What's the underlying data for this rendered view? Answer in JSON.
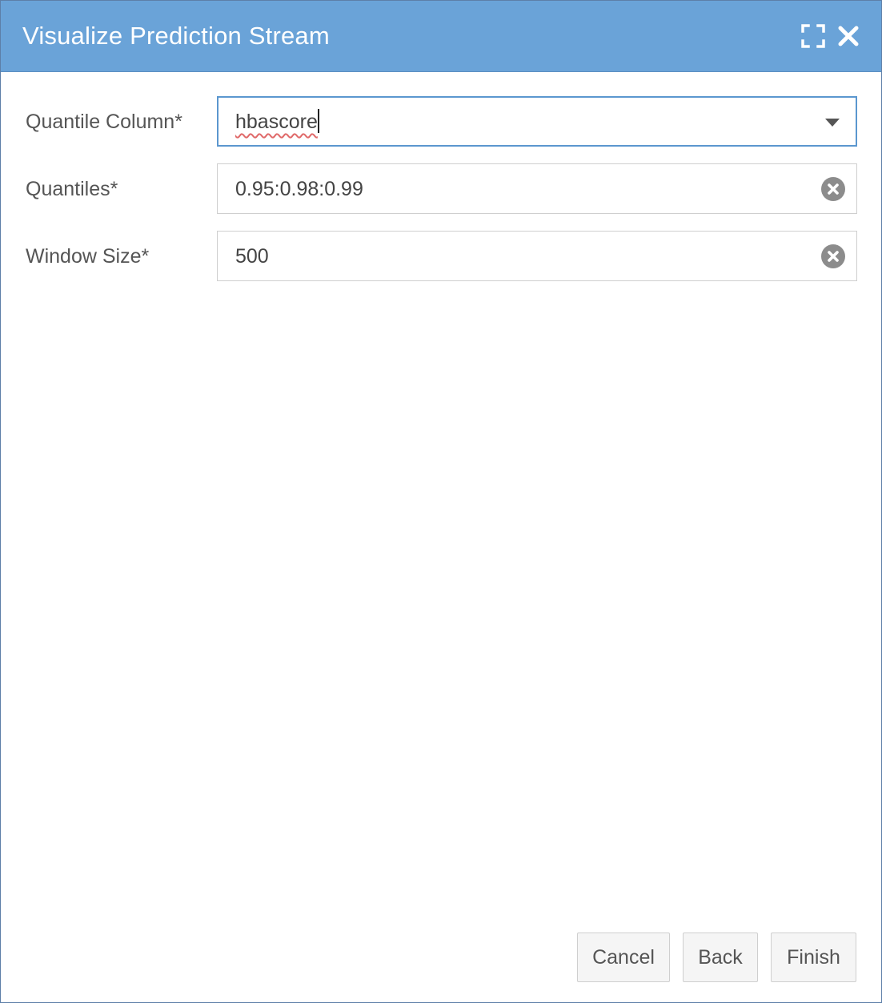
{
  "dialog": {
    "title": "Visualize Prediction Stream",
    "maximize_icon": "maximize-icon",
    "close_icon": "close-icon"
  },
  "form": {
    "quantile_column": {
      "label": "Quantile Column*",
      "value": "hbascore",
      "control": "dropdown"
    },
    "quantiles": {
      "label": "Quantiles*",
      "value": "0.95:0.98:0.99"
    },
    "window_size": {
      "label": "Window Size*",
      "value": "500"
    }
  },
  "footer": {
    "cancel_label": "Cancel",
    "back_label": "Back",
    "finish_label": "Finish"
  },
  "colors": {
    "titlebar": "#6aa3d8",
    "focus_border": "#5b97cf",
    "clear_icon": "#8c8c8c"
  }
}
